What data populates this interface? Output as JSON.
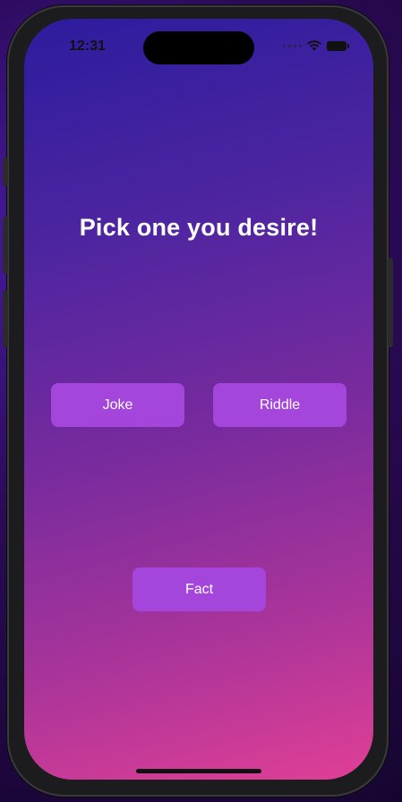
{
  "status_bar": {
    "time": "12:31",
    "wifi_icon": "wifi-icon",
    "battery_icon": "battery-icon"
  },
  "main": {
    "title": "Pick one you desire!",
    "buttons": {
      "joke": "Joke",
      "riddle": "Riddle",
      "fact": "Fact"
    }
  },
  "colors": {
    "button_bg": "#a445dc",
    "gradient_top": "#2c1c9e",
    "gradient_bottom": "#e03f95"
  }
}
